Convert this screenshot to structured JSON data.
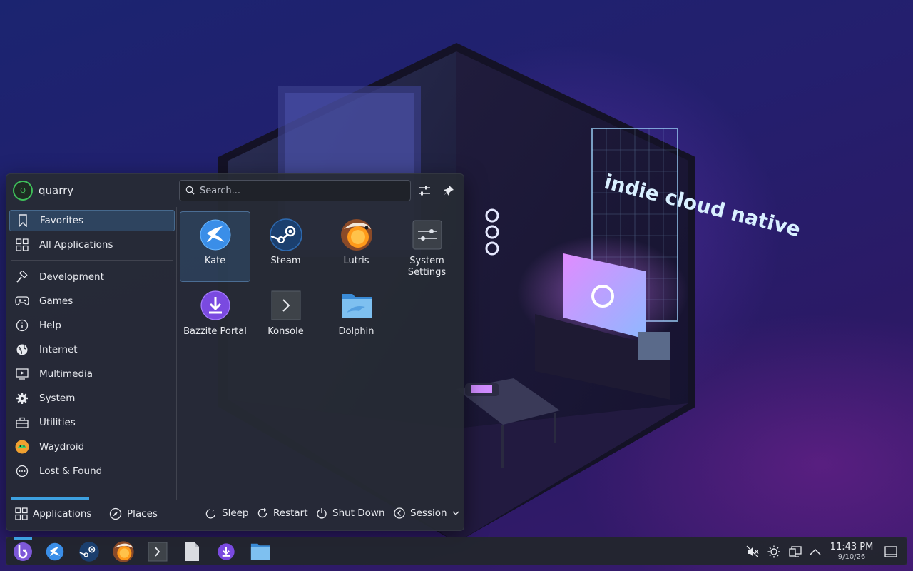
{
  "user": {
    "name": "quarry",
    "avatar_letter": "Q"
  },
  "search": {
    "placeholder": "Search..."
  },
  "sidebar": {
    "items": [
      {
        "label": "Favorites",
        "icon": "bookmark-icon",
        "active": true
      },
      {
        "label": "All Applications",
        "icon": "grid-icon"
      }
    ],
    "categories": [
      {
        "label": "Development",
        "icon": "hammer-icon"
      },
      {
        "label": "Games",
        "icon": "gamepad-icon"
      },
      {
        "label": "Help",
        "icon": "info-icon"
      },
      {
        "label": "Internet",
        "icon": "globe-icon"
      },
      {
        "label": "Multimedia",
        "icon": "monitor-play-icon"
      },
      {
        "label": "System",
        "icon": "gear-icon"
      },
      {
        "label": "Utilities",
        "icon": "toolbox-icon"
      },
      {
        "label": "Waydroid",
        "icon": "android-icon"
      },
      {
        "label": "Lost & Found",
        "icon": "dots-circle-icon"
      }
    ]
  },
  "apps": [
    {
      "label": "Kate",
      "icon": "kate-icon"
    },
    {
      "label": "Steam",
      "icon": "steam-icon"
    },
    {
      "label": "Lutris",
      "icon": "lutris-icon"
    },
    {
      "label": "System Settings",
      "icon": "settings-sliders-icon"
    },
    {
      "label": "Bazzite Portal",
      "icon": "download-icon"
    },
    {
      "label": "Konsole",
      "icon": "terminal-icon"
    },
    {
      "label": "Dolphin",
      "icon": "folder-icon"
    }
  ],
  "footer": {
    "applications": "Applications",
    "places": "Places",
    "sleep": "Sleep",
    "restart": "Restart",
    "shutdown": "Shut Down",
    "session": "Session"
  },
  "wallpaper": {
    "neon_sign": "indie cloud native"
  },
  "taskbar": {
    "apps": [
      "bazzite-launcher-icon",
      "kate-icon",
      "steam-icon",
      "lutris-icon",
      "terminal-icon",
      "file-icon",
      "download-icon",
      "folder-icon"
    ],
    "tray": [
      "volume-muted-icon",
      "brightness-icon",
      "display-icon",
      "expand-arrow-icon"
    ],
    "time": "11:43 PM",
    "date": "9/10/26"
  },
  "colors": {
    "accent": "#3da0e0",
    "panel": "#262a34",
    "avatar_ring": "#3fbf5a"
  }
}
